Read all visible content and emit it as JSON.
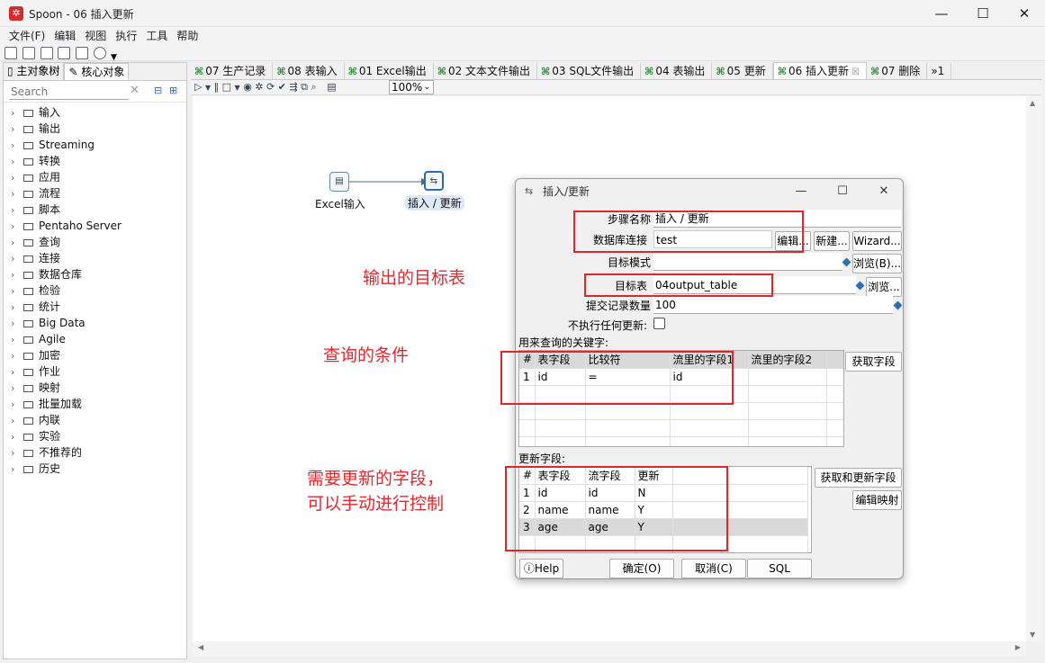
{
  "window": {
    "title": "Spoon - 06 插入更新",
    "app_icon": "spoon-icon",
    "minimize": "—",
    "maximize": "☐",
    "close": "✕"
  },
  "menu": [
    "文件(F)",
    "编辑",
    "视图",
    "执行",
    "工具",
    "帮助"
  ],
  "left_panel": {
    "tabs": [
      "主对象树",
      "核心对象"
    ],
    "search_placeholder": "Search",
    "tree": [
      "输入",
      "输出",
      "Streaming",
      "转换",
      "应用",
      "流程",
      "脚本",
      "Pentaho Server",
      "查询",
      "连接",
      "数据仓库",
      "检验",
      "统计",
      "Big Data",
      "Agile",
      "加密",
      "作业",
      "映射",
      "批量加载",
      "内联",
      "实验",
      "不推荐的",
      "历史"
    ]
  },
  "editor_tabs": [
    "07 生产记录",
    "08 表输入",
    "01 Excel输出",
    "02 文本文件输出",
    "03 SQL文件输出",
    "04 表输出",
    "05 更新",
    "06 插入更新",
    "07 删除"
  ],
  "editor_tabs_overflow": "»1",
  "zoom": "100%",
  "canvas": {
    "nodes": [
      {
        "label": "Excel输入",
        "icon": "excel-input-icon"
      },
      {
        "label": "插入 / 更新",
        "icon": "insert-update-icon"
      }
    ],
    "annotations": [
      "输出的目标表",
      "查询的条件",
      "需要更新的字段，",
      "可以手动进行控制"
    ]
  },
  "dialog": {
    "title": "插入/更新",
    "labels": {
      "step_name": "步骤名称",
      "connection": "数据库连接",
      "schema": "目标模式",
      "table": "目标表",
      "commit": "提交记录数量",
      "no_update": "不执行任何更新:",
      "keys_section": "用来查询的关键字:",
      "update_section": "更新字段:"
    },
    "values": {
      "step_name": "插入 / 更新",
      "connection": "test",
      "schema": "",
      "table": "04output_table",
      "commit": "100"
    },
    "buttons": {
      "edit": "编辑...",
      "new": "新建...",
      "wizard": "Wizard...",
      "browse_schema": "浏览(B)...",
      "browse_table": "浏览...",
      "get_fields": "获取字段",
      "get_update_fields": "获取和更新字段",
      "edit_mapping": "编辑映射",
      "help": "Help",
      "ok": "确定(O)",
      "cancel": "取消(C)",
      "sql": "SQL"
    },
    "keys_table": {
      "headers": [
        "#",
        "表字段",
        "比较符",
        "流里的字段1",
        "流里的字段2"
      ],
      "rows": [
        [
          "1",
          "id",
          "=",
          "id",
          ""
        ]
      ]
    },
    "update_table": {
      "headers": [
        "#",
        "表字段",
        "流字段",
        "更新"
      ],
      "rows": [
        [
          "1",
          "id",
          "id",
          "N"
        ],
        [
          "2",
          "name",
          "name",
          "Y"
        ],
        [
          "3",
          "age",
          "age",
          "Y"
        ]
      ]
    }
  },
  "colors": {
    "annotation": "#e8262b",
    "hop": "#4a6a8a"
  }
}
